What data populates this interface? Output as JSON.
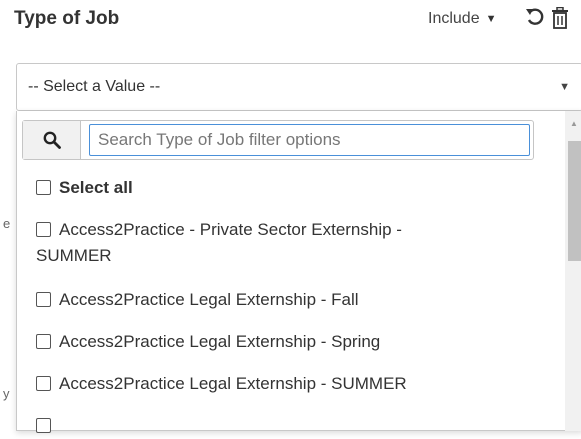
{
  "filter": {
    "title": "Type of Job",
    "mode_label": "Include",
    "select_placeholder": "-- Select a Value --"
  },
  "dropdown": {
    "search_placeholder": "Search Type of Job filter options",
    "select_all_label": "Select all",
    "options": [
      {
        "line1": "Access2Practice - Private Sector Externship -",
        "line2": "SUMMER"
      },
      {
        "line1": "Access2Practice Legal Externship - Fall"
      },
      {
        "line1": "Access2Practice Legal Externship - Spring"
      },
      {
        "line1": "Access2Practice Legal Externship - SUMMER"
      }
    ]
  },
  "background_fragments": [
    "e",
    "y"
  ],
  "icons": [
    "chevron-down-icon",
    "reset-icon",
    "trash-icon",
    "search-icon"
  ],
  "colors": {
    "focus_border": "#4a90d9",
    "text": "#333333"
  }
}
